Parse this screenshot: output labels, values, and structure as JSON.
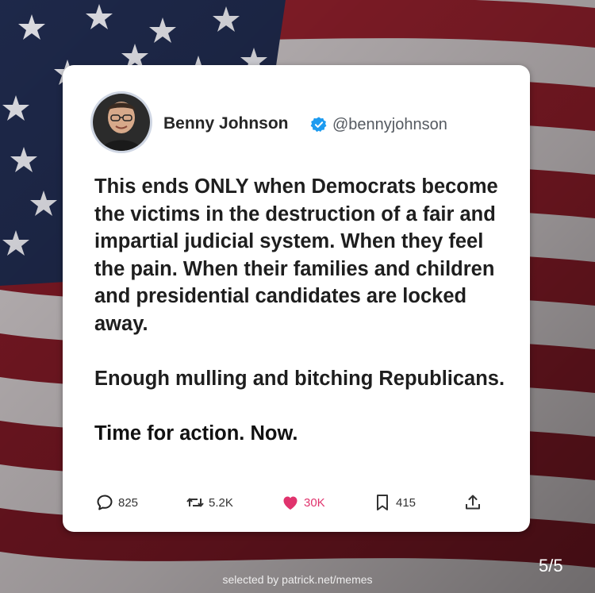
{
  "tweet": {
    "author_name": "Benny Johnson",
    "author_handle": "@bennyjohnson",
    "verified_icon": "verified-badge-icon",
    "paragraphs": [
      "This ends ONLY when Democrats become the victims in the destruction of a fair and impartial judicial system. When they feel the pain. When their families and children and presidential candidates are locked away.",
      "Enough mulling and bitching Republicans.",
      "Time for action. Now."
    ],
    "actions": {
      "replies": "825",
      "retweets": "5.2K",
      "likes": "30K",
      "bookmarks": "415"
    }
  },
  "footer": {
    "credit": "selected by patrick.net/memes",
    "page_indicator": "5/5"
  },
  "colors": {
    "like": "#e0336d",
    "verified": "#1d9bf0",
    "flag_red": "#8e1f2b",
    "flag_blue": "#1f2a4d"
  }
}
